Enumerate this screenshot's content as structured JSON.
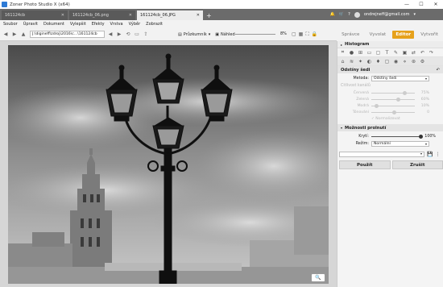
{
  "window": {
    "title": "Zoner Photo Studio X (x64)",
    "minimize": "—",
    "maximize": "☐",
    "close": "✕"
  },
  "tabs": [
    {
      "label": "161124cb",
      "close": "✕"
    },
    {
      "label": "161124cb_06.png",
      "close": "✕"
    },
    {
      "label": "161124cb_06.JPG",
      "close": "✕"
    }
  ],
  "tab_add": "+",
  "account": {
    "bell": "🔔",
    "cart": "🛒",
    "help": "?",
    "email": "ondrejneff@gmail.com",
    "caret": "▾"
  },
  "menu": [
    "Soubor",
    "Úpravit",
    "Dokument",
    "Vylepšit",
    "Efekty",
    "Vrstva",
    "Výběr",
    "Zobrazit"
  ],
  "toolbar": {
    "back": "◀",
    "forward": "▶",
    "up": "▲",
    "path": "J:\\digineff\\zdroj\\2016\\c...\\161124cb",
    "explorer_label": "Průzkumník",
    "preview_label": "Náhled",
    "zoom_value": "8%"
  },
  "modes": [
    {
      "label": "Správce"
    },
    {
      "label": "Vyvolat"
    },
    {
      "label": "Editor"
    },
    {
      "label": "Vytvořit"
    }
  ],
  "panel": {
    "histogram_title": "Histogram",
    "section_title": "Odstíny šedi",
    "undo_symbol": "↶",
    "method_label": "Metoda:",
    "method_value": "Odstíny šedi",
    "channels_label": "Citlivost kanálů",
    "sliders": [
      {
        "label": "Červená",
        "value": "75%",
        "pos": 0.75
      },
      {
        "label": "Zelená",
        "value": "60%",
        "pos": 0.6
      },
      {
        "label": "Modrá",
        "value": "10%",
        "pos": 0.1
      },
      {
        "label": "Tónování",
        "value": "0",
        "pos": 0.5
      }
    ],
    "normalize_label": "✓ Normalizovat",
    "blend_title": "Možnosti prolnutí",
    "opacity_label": "Krytí:",
    "opacity_value": "100%",
    "mode_label": "Režim:",
    "mode_value": "Normální",
    "apply_label": "Použít",
    "cancel_label": "Zrušit"
  },
  "viewer": {
    "navigator_icon": "🔍"
  }
}
